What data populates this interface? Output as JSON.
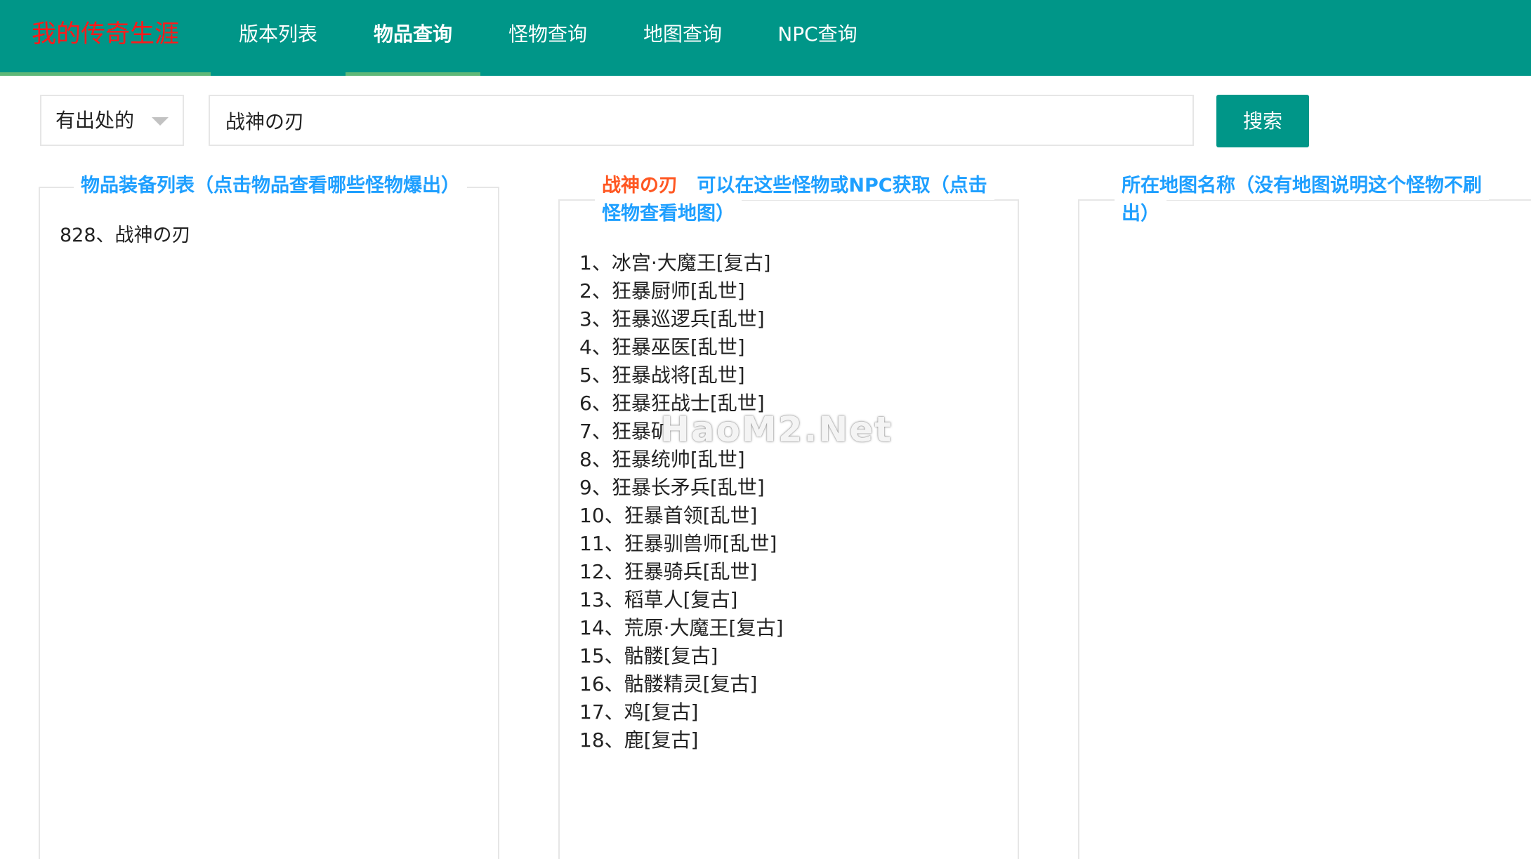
{
  "nav": {
    "brand": "我的传奇生涯",
    "items": [
      "版本列表",
      "物品查询",
      "怪物查询",
      "地图查询",
      "NPC查询"
    ],
    "active_index": 1
  },
  "search": {
    "filter_selected": "有出处的",
    "query": "战神の刃",
    "button_label": "搜索"
  },
  "panels": {
    "items": {
      "title": "物品装备列表（点击物品查看哪些怪物爆出）",
      "results": [
        "828、战神の刃"
      ]
    },
    "sources": {
      "title_item": "战神の刃",
      "title_line1_rest": "可以在这些怪物或NPC获取（点击",
      "title_line2": "怪物查看地图）",
      "monsters": [
        "1、冰宫·大魔王[复古]",
        "2、狂暴厨师[乱世]",
        "3、狂暴巡逻兵[乱世]",
        "4、狂暴巫医[乱世]",
        "5、狂暴战将[乱世]",
        "6、狂暴狂战士[乱世]",
        "7、狂暴矿",
        "8、狂暴统帅[乱世]",
        "9、狂暴长矛兵[乱世]",
        "10、狂暴首领[乱世]",
        "11、狂暴驯兽师[乱世]",
        "12、狂暴骑兵[乱世]",
        "13、稻草人[复古]",
        "14、荒原·大魔王[复古]",
        "15、骷髅[复古]",
        "16、骷髅精灵[复古]",
        "17、鸡[复古]",
        "18、鹿[复古]"
      ]
    },
    "maps": {
      "title_line1": "所在地图名称（没有地图说明这个怪物不刷",
      "title_line2": "出）"
    }
  },
  "watermark": "HaoM2.Net",
  "colors": {
    "nav_bg": "#009688",
    "brand": "#ff1a1a",
    "title_blue": "#1E9FFF",
    "title_orange": "#FF5722",
    "button_bg": "#009688"
  }
}
